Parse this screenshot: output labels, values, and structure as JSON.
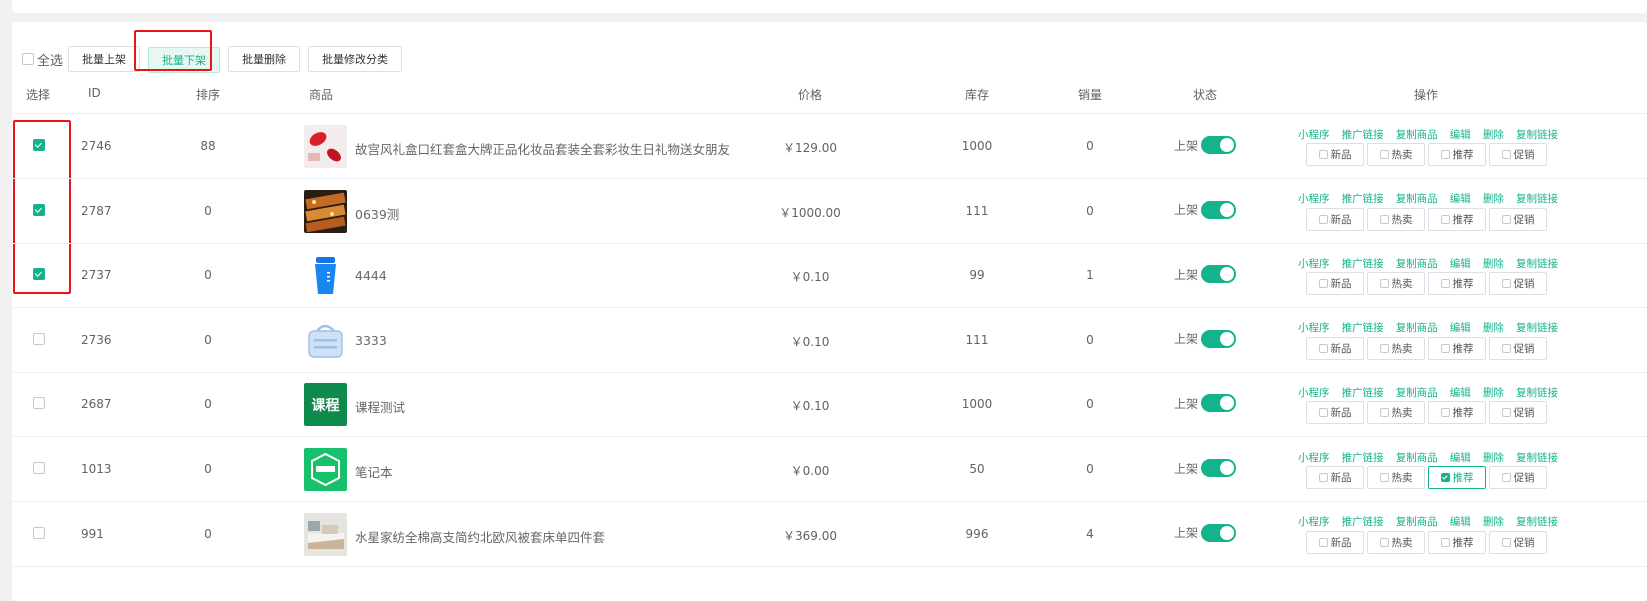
{
  "toolbar": {
    "select_all": "全选",
    "buttons": [
      "批量上架",
      "批量下架",
      "批量删除",
      "批量修改分类"
    ]
  },
  "table": {
    "headers": {
      "select": "选择",
      "id": "ID",
      "sort": "排序",
      "goods": "商品",
      "price": "价格",
      "stock": "库存",
      "sales": "销量",
      "status": "状态",
      "ops": "操作"
    },
    "op_links": [
      "小程序",
      "推广链接",
      "复制商品",
      "编辑",
      "删除",
      "复制链接"
    ],
    "tag_labels": [
      "新品",
      "热卖",
      "推荐",
      "促销"
    ],
    "status_label": "上架",
    "rows": [
      {
        "checked": true,
        "id": "2746",
        "sort": "88",
        "name": "故宫风礼盒口红套盒大牌正品化妆品套装全套彩妆生日礼物送女朋友",
        "price": "￥129.00",
        "stock": "1000",
        "sales": "0",
        "thumb": "lipstick",
        "tags": [
          false,
          false,
          false,
          false
        ]
      },
      {
        "checked": true,
        "id": "2787",
        "sort": "0",
        "name": "0639测",
        "price": "￥1000.00",
        "stock": "111",
        "sales": "0",
        "thumb": "food",
        "tags": [
          false,
          false,
          false,
          false
        ]
      },
      {
        "checked": true,
        "id": "2737",
        "sort": "0",
        "name": "4444",
        "price": "￥0.10",
        "stock": "99",
        "sales": "1",
        "thumb": "cup",
        "tags": [
          false,
          false,
          false,
          false
        ]
      },
      {
        "checked": false,
        "id": "2736",
        "sort": "0",
        "name": "3333",
        "price": "￥0.10",
        "stock": "111",
        "sales": "0",
        "thumb": "basket",
        "tags": [
          false,
          false,
          false,
          false
        ]
      },
      {
        "checked": false,
        "id": "2687",
        "sort": "0",
        "name": "课程测试",
        "price": "￥0.10",
        "stock": "1000",
        "sales": "0",
        "thumb": "course",
        "thumb_text": "课程",
        "tags": [
          false,
          false,
          false,
          false
        ]
      },
      {
        "checked": false,
        "id": "1013",
        "sort": "0",
        "name": "笔记本",
        "price": "￥0.00",
        "stock": "50",
        "sales": "0",
        "thumb": "hexagon",
        "tags": [
          false,
          false,
          true,
          false
        ]
      },
      {
        "checked": false,
        "id": "991",
        "sort": "0",
        "name": "水星家纺全棉高支简约北欧风被套床单四件套",
        "price": "￥369.00",
        "stock": "996",
        "sales": "4",
        "thumb": "bedding",
        "tags": [
          false,
          false,
          false,
          false
        ]
      }
    ]
  },
  "colors": {
    "accent": "#13b38d",
    "highlight": "#e8151b"
  }
}
